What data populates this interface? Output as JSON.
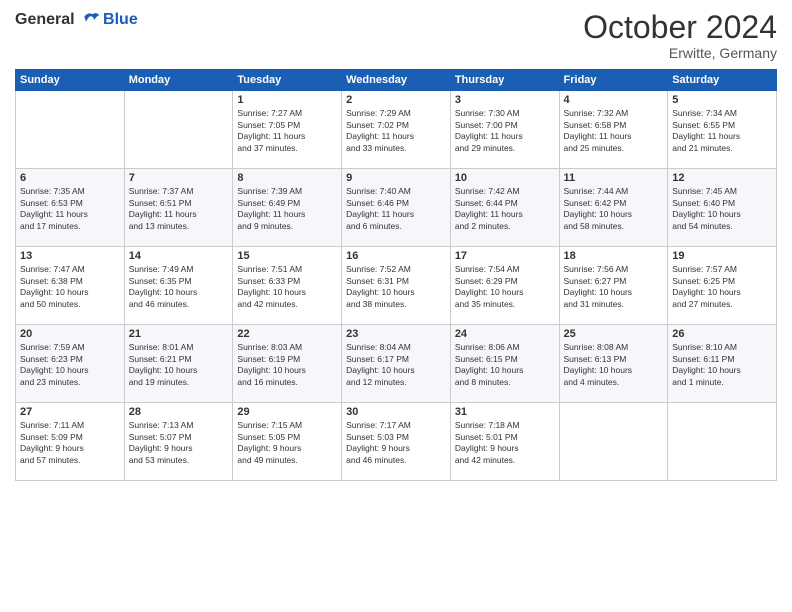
{
  "header": {
    "logo_line1": "General",
    "logo_line2": "Blue",
    "month": "October 2024",
    "location": "Erwitte, Germany"
  },
  "days_of_week": [
    "Sunday",
    "Monday",
    "Tuesday",
    "Wednesday",
    "Thursday",
    "Friday",
    "Saturday"
  ],
  "weeks": [
    [
      {
        "day": "",
        "content": ""
      },
      {
        "day": "",
        "content": ""
      },
      {
        "day": "1",
        "content": "Sunrise: 7:27 AM\nSunset: 7:05 PM\nDaylight: 11 hours\nand 37 minutes."
      },
      {
        "day": "2",
        "content": "Sunrise: 7:29 AM\nSunset: 7:02 PM\nDaylight: 11 hours\nand 33 minutes."
      },
      {
        "day": "3",
        "content": "Sunrise: 7:30 AM\nSunset: 7:00 PM\nDaylight: 11 hours\nand 29 minutes."
      },
      {
        "day": "4",
        "content": "Sunrise: 7:32 AM\nSunset: 6:58 PM\nDaylight: 11 hours\nand 25 minutes."
      },
      {
        "day": "5",
        "content": "Sunrise: 7:34 AM\nSunset: 6:55 PM\nDaylight: 11 hours\nand 21 minutes."
      }
    ],
    [
      {
        "day": "6",
        "content": "Sunrise: 7:35 AM\nSunset: 6:53 PM\nDaylight: 11 hours\nand 17 minutes."
      },
      {
        "day": "7",
        "content": "Sunrise: 7:37 AM\nSunset: 6:51 PM\nDaylight: 11 hours\nand 13 minutes."
      },
      {
        "day": "8",
        "content": "Sunrise: 7:39 AM\nSunset: 6:49 PM\nDaylight: 11 hours\nand 9 minutes."
      },
      {
        "day": "9",
        "content": "Sunrise: 7:40 AM\nSunset: 6:46 PM\nDaylight: 11 hours\nand 6 minutes."
      },
      {
        "day": "10",
        "content": "Sunrise: 7:42 AM\nSunset: 6:44 PM\nDaylight: 11 hours\nand 2 minutes."
      },
      {
        "day": "11",
        "content": "Sunrise: 7:44 AM\nSunset: 6:42 PM\nDaylight: 10 hours\nand 58 minutes."
      },
      {
        "day": "12",
        "content": "Sunrise: 7:45 AM\nSunset: 6:40 PM\nDaylight: 10 hours\nand 54 minutes."
      }
    ],
    [
      {
        "day": "13",
        "content": "Sunrise: 7:47 AM\nSunset: 6:38 PM\nDaylight: 10 hours\nand 50 minutes."
      },
      {
        "day": "14",
        "content": "Sunrise: 7:49 AM\nSunset: 6:35 PM\nDaylight: 10 hours\nand 46 minutes."
      },
      {
        "day": "15",
        "content": "Sunrise: 7:51 AM\nSunset: 6:33 PM\nDaylight: 10 hours\nand 42 minutes."
      },
      {
        "day": "16",
        "content": "Sunrise: 7:52 AM\nSunset: 6:31 PM\nDaylight: 10 hours\nand 38 minutes."
      },
      {
        "day": "17",
        "content": "Sunrise: 7:54 AM\nSunset: 6:29 PM\nDaylight: 10 hours\nand 35 minutes."
      },
      {
        "day": "18",
        "content": "Sunrise: 7:56 AM\nSunset: 6:27 PM\nDaylight: 10 hours\nand 31 minutes."
      },
      {
        "day": "19",
        "content": "Sunrise: 7:57 AM\nSunset: 6:25 PM\nDaylight: 10 hours\nand 27 minutes."
      }
    ],
    [
      {
        "day": "20",
        "content": "Sunrise: 7:59 AM\nSunset: 6:23 PM\nDaylight: 10 hours\nand 23 minutes."
      },
      {
        "day": "21",
        "content": "Sunrise: 8:01 AM\nSunset: 6:21 PM\nDaylight: 10 hours\nand 19 minutes."
      },
      {
        "day": "22",
        "content": "Sunrise: 8:03 AM\nSunset: 6:19 PM\nDaylight: 10 hours\nand 16 minutes."
      },
      {
        "day": "23",
        "content": "Sunrise: 8:04 AM\nSunset: 6:17 PM\nDaylight: 10 hours\nand 12 minutes."
      },
      {
        "day": "24",
        "content": "Sunrise: 8:06 AM\nSunset: 6:15 PM\nDaylight: 10 hours\nand 8 minutes."
      },
      {
        "day": "25",
        "content": "Sunrise: 8:08 AM\nSunset: 6:13 PM\nDaylight: 10 hours\nand 4 minutes."
      },
      {
        "day": "26",
        "content": "Sunrise: 8:10 AM\nSunset: 6:11 PM\nDaylight: 10 hours\nand 1 minute."
      }
    ],
    [
      {
        "day": "27",
        "content": "Sunrise: 7:11 AM\nSunset: 5:09 PM\nDaylight: 9 hours\nand 57 minutes."
      },
      {
        "day": "28",
        "content": "Sunrise: 7:13 AM\nSunset: 5:07 PM\nDaylight: 9 hours\nand 53 minutes."
      },
      {
        "day": "29",
        "content": "Sunrise: 7:15 AM\nSunset: 5:05 PM\nDaylight: 9 hours\nand 49 minutes."
      },
      {
        "day": "30",
        "content": "Sunrise: 7:17 AM\nSunset: 5:03 PM\nDaylight: 9 hours\nand 46 minutes."
      },
      {
        "day": "31",
        "content": "Sunrise: 7:18 AM\nSunset: 5:01 PM\nDaylight: 9 hours\nand 42 minutes."
      },
      {
        "day": "",
        "content": ""
      },
      {
        "day": "",
        "content": ""
      }
    ]
  ]
}
